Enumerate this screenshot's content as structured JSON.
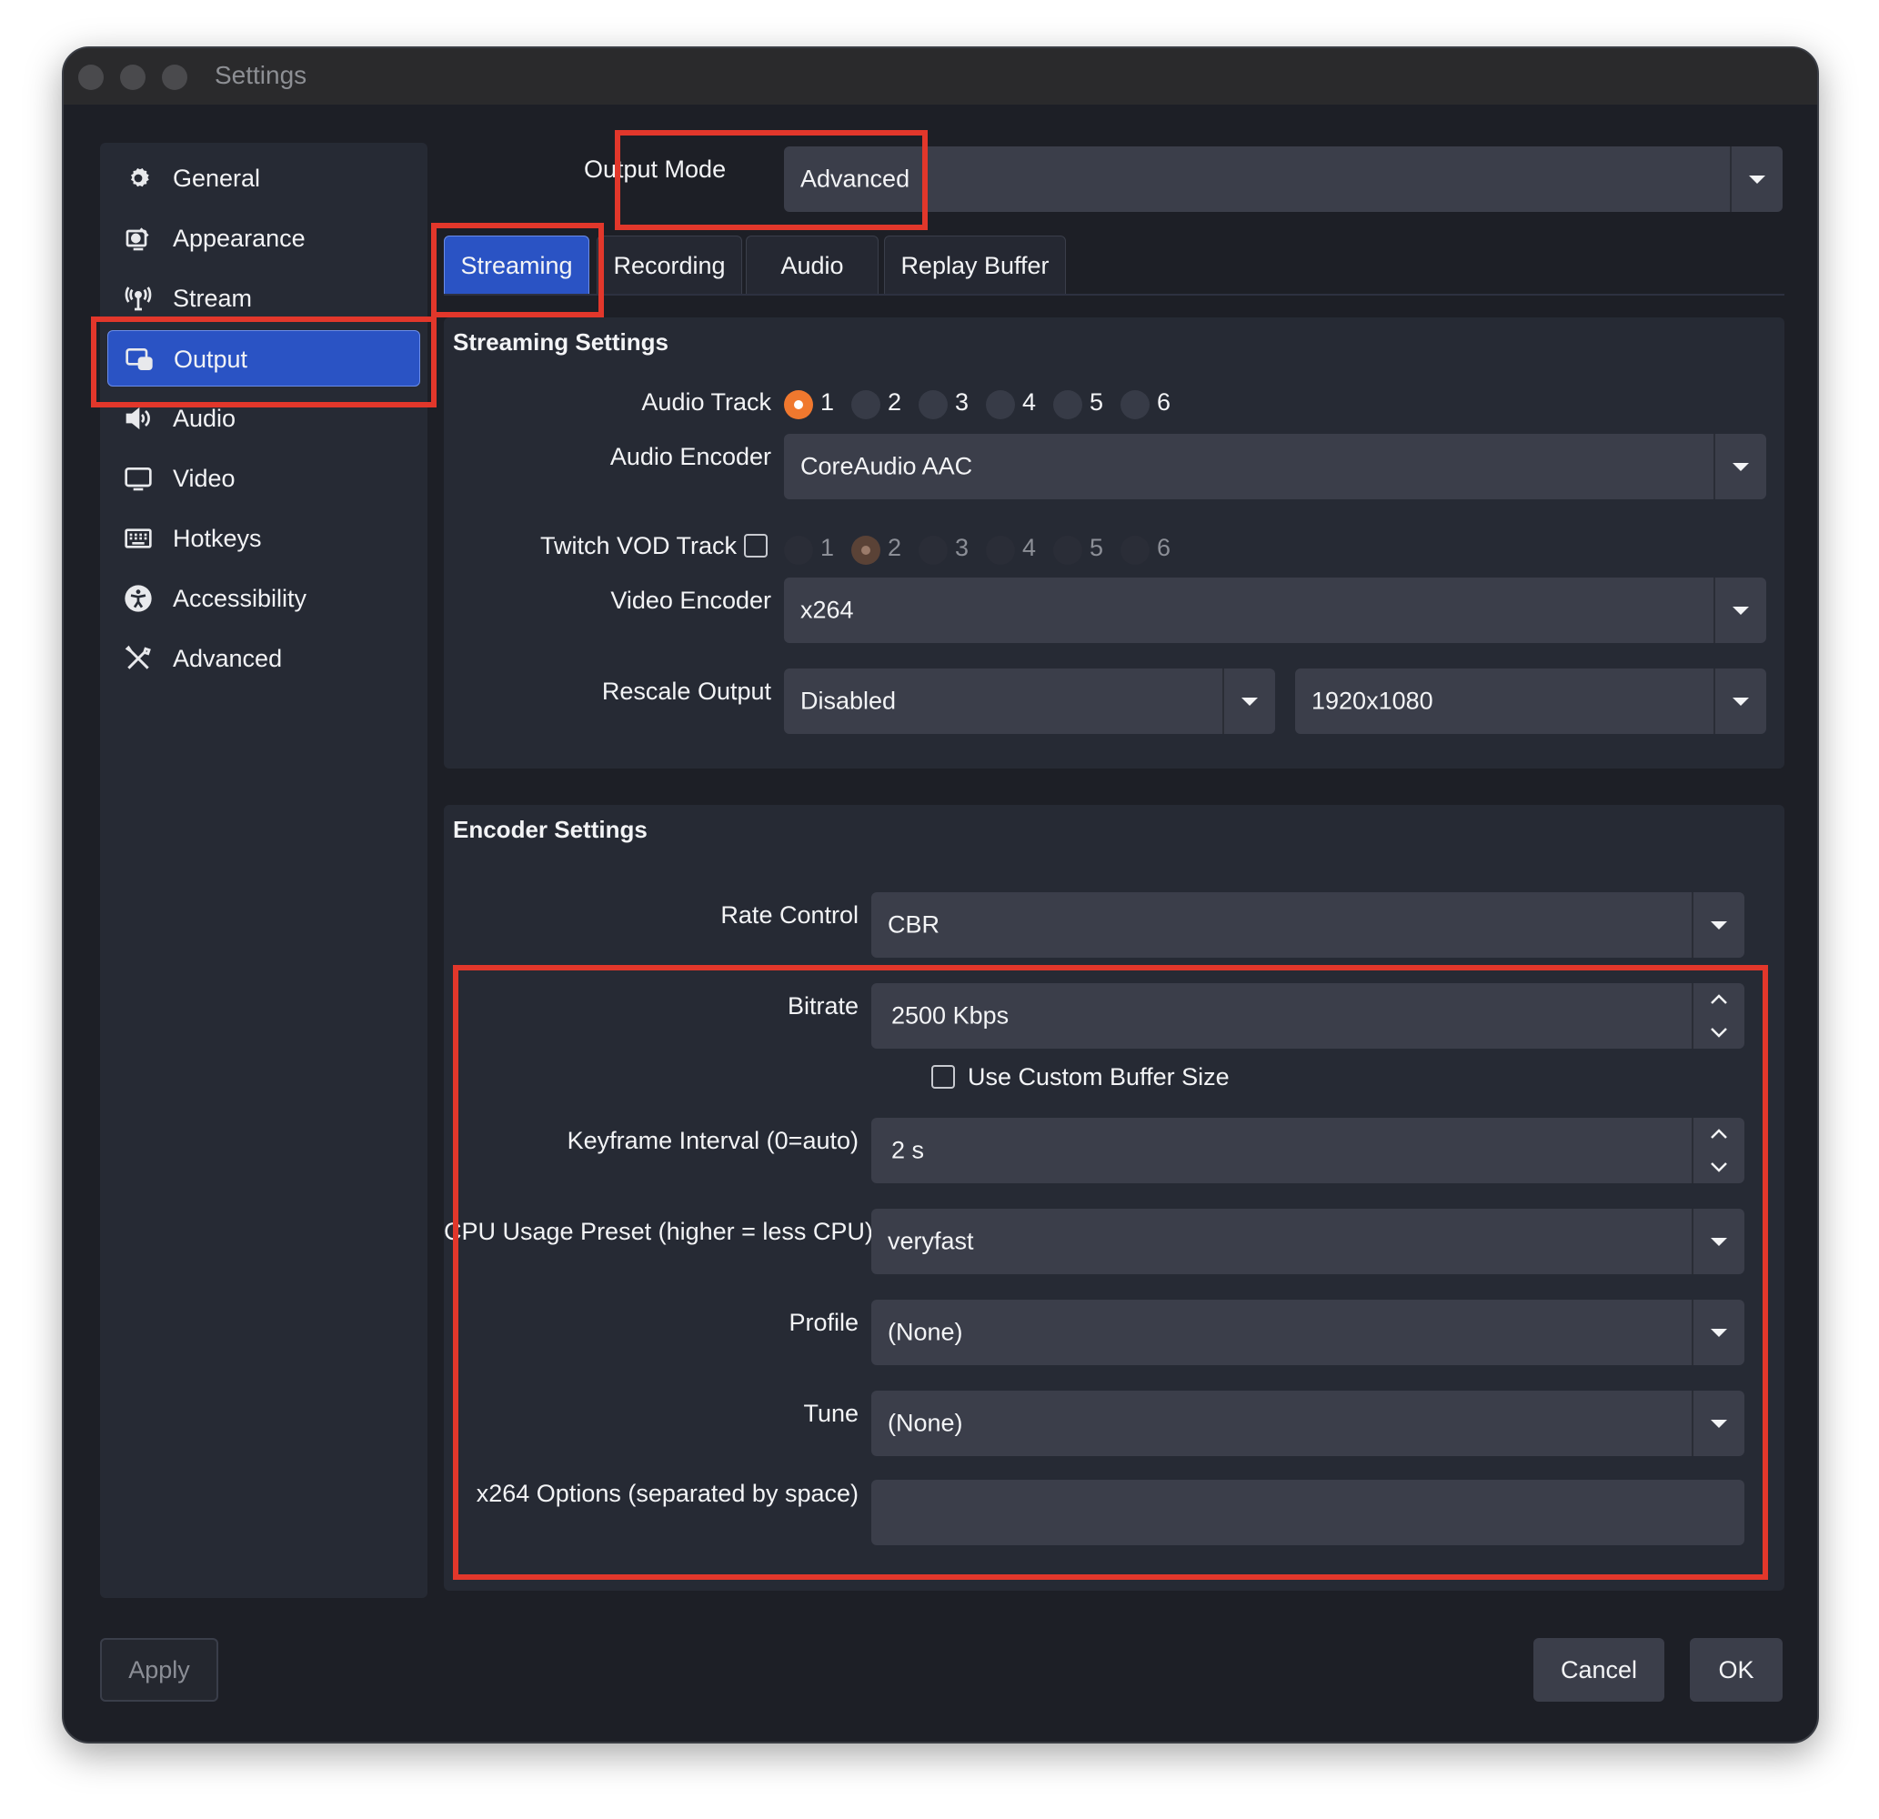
{
  "window": {
    "title": "Settings"
  },
  "sidebar": {
    "items": [
      {
        "label": "General",
        "icon": "gear-icon"
      },
      {
        "label": "Appearance",
        "icon": "appearance-icon"
      },
      {
        "label": "Stream",
        "icon": "antenna-icon"
      },
      {
        "label": "Output",
        "icon": "output-icon",
        "selected": true
      },
      {
        "label": "Audio",
        "icon": "speaker-icon"
      },
      {
        "label": "Video",
        "icon": "monitor-icon"
      },
      {
        "label": "Hotkeys",
        "icon": "keyboard-icon"
      },
      {
        "label": "Accessibility",
        "icon": "accessibility-icon"
      },
      {
        "label": "Advanced",
        "icon": "tools-icon"
      }
    ]
  },
  "output_mode": {
    "label": "Output Mode",
    "value": "Advanced"
  },
  "tabs": [
    {
      "label": "Streaming",
      "selected": true
    },
    {
      "label": "Recording"
    },
    {
      "label": "Audio"
    },
    {
      "label": "Replay Buffer"
    }
  ],
  "streaming_settings": {
    "title": "Streaming Settings",
    "audio_track": {
      "label": "Audio Track",
      "options": [
        "1",
        "2",
        "3",
        "4",
        "5",
        "6"
      ],
      "selected": "1"
    },
    "audio_encoder": {
      "label": "Audio Encoder",
      "value": "CoreAudio AAC"
    },
    "twitch_vod": {
      "label": "Twitch VOD Track",
      "checked": false,
      "options": [
        "1",
        "2",
        "3",
        "4",
        "5",
        "6"
      ],
      "selected": "2"
    },
    "video_encoder": {
      "label": "Video Encoder",
      "value": "x264"
    },
    "rescale_output": {
      "label": "Rescale Output",
      "value": "Disabled",
      "resolution": "1920x1080"
    }
  },
  "encoder_settings": {
    "title": "Encoder Settings",
    "rate_control": {
      "label": "Rate Control",
      "value": "CBR"
    },
    "bitrate": {
      "label": "Bitrate",
      "value": "2500 Kbps"
    },
    "custom_buffer": {
      "label": "Use Custom Buffer Size",
      "checked": false
    },
    "keyframe": {
      "label": "Keyframe Interval (0=auto)",
      "value": "2 s"
    },
    "cpu_preset": {
      "label": "CPU Usage Preset (higher = less CPU)",
      "value": "veryfast"
    },
    "profile": {
      "label": "Profile",
      "value": "(None)"
    },
    "tune": {
      "label": "Tune",
      "value": "(None)"
    },
    "x264_options": {
      "label": "x264 Options (separated by space)",
      "value": ""
    }
  },
  "buttons": {
    "apply": "Apply",
    "cancel": "Cancel",
    "ok": "OK"
  },
  "colors": {
    "highlight": "#e2372b",
    "accent": "#2a53c4",
    "radio_on": "#f0782e"
  }
}
